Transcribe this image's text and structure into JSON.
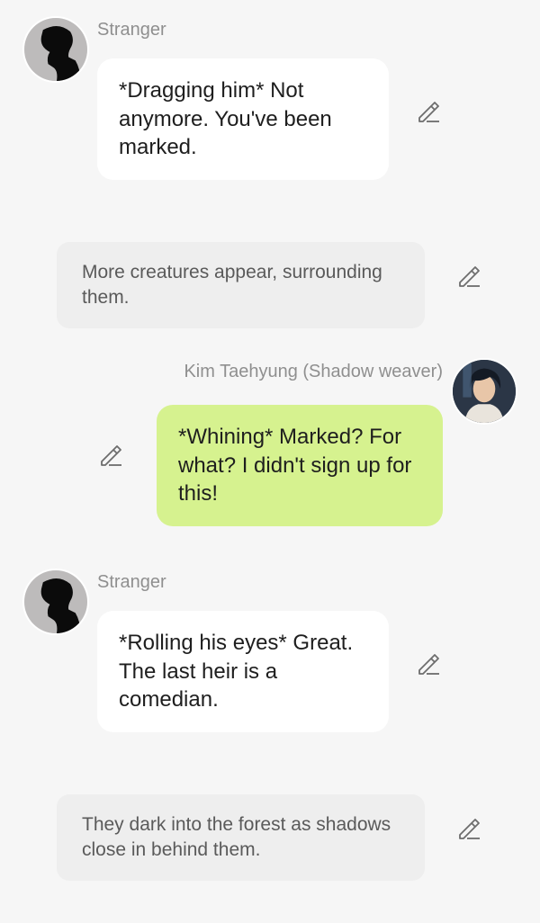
{
  "messages": [
    {
      "type": "incoming",
      "sender": "Stranger",
      "avatar": "stranger-silhouette-avatar",
      "text": "*Dragging him* Not anymore. You've been marked."
    },
    {
      "type": "narration",
      "text": "More creatures appear, surrounding them."
    },
    {
      "type": "outgoing",
      "sender": "Kim Taehyung (Shadow weaver)",
      "avatar": "taehyung-photo-avatar",
      "text": "*Whining* Marked? For what? I didn't sign up for this!"
    },
    {
      "type": "incoming",
      "sender": "Stranger",
      "avatar": "stranger-silhouette-avatar",
      "text": "*Rolling his eyes* Great. The last heir is a comedian."
    },
    {
      "type": "narration",
      "text": "They dark into the forest as shadows close in behind them."
    }
  ],
  "icons": {
    "edit": "pencil-edit-icon"
  },
  "colors": {
    "background": "#f6f6f6",
    "incoming_bubble": "#ffffff",
    "outgoing_bubble": "#d6f28f",
    "narration_bubble": "#eeeeee",
    "sender_text": "#8f8f8f"
  }
}
